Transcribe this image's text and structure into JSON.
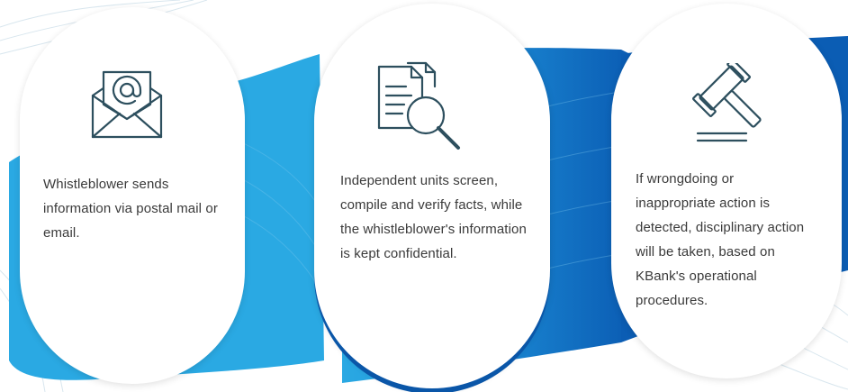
{
  "steps": [
    {
      "icon": "email-envelope-icon",
      "text": "Whistleblower sends information via postal mail or email."
    },
    {
      "icon": "document-search-icon",
      "text": "Independent units screen, compile and verify facts, while the whistleblower's information is kept confidential."
    },
    {
      "icon": "gavel-icon",
      "text": "If wrongdoing or inappropriate action is detected, disciplinary action will be taken, based on KBank's operational procedures."
    }
  ],
  "colors": {
    "ribbon_light": "#2aa9e3",
    "ribbon_dark": "#0b5db4",
    "icon_stroke": "#2d4f5e",
    "text": "#3a3a3a"
  }
}
